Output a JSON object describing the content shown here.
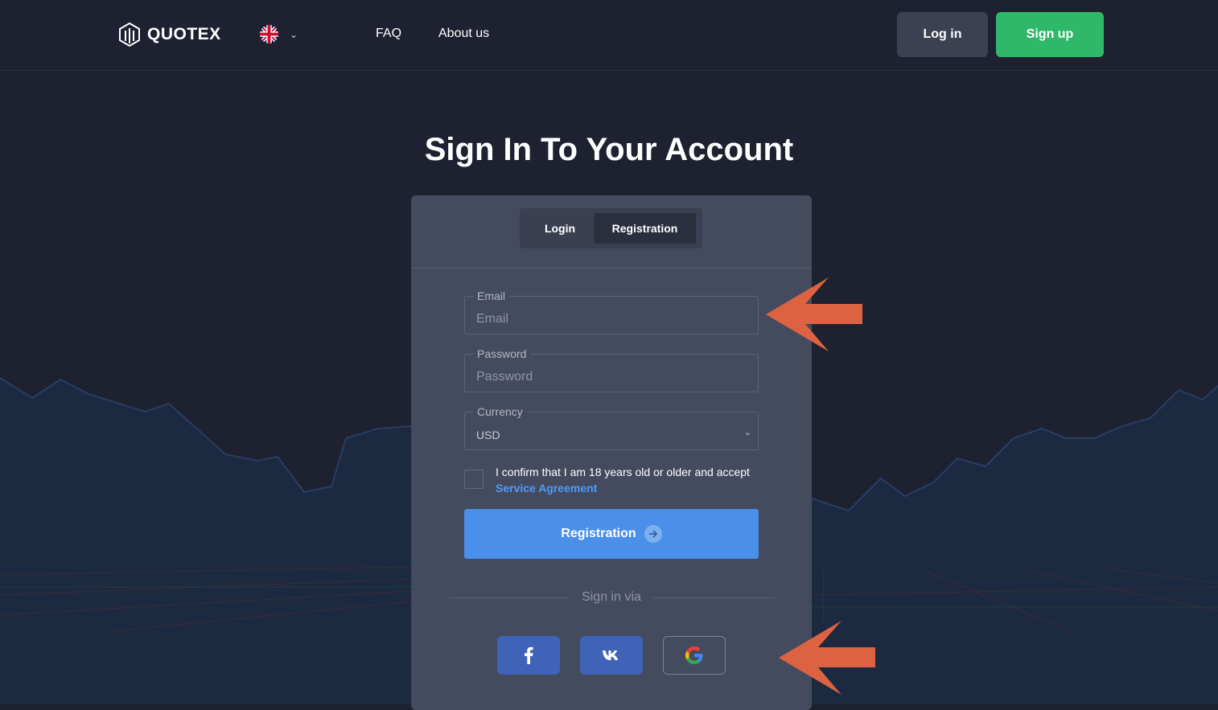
{
  "header": {
    "logo_text": "QUOTEX",
    "nav": {
      "faq": "FAQ",
      "about": "About us"
    },
    "login_label": "Log in",
    "signup_label": "Sign up"
  },
  "page": {
    "title": "Sign In To Your Account"
  },
  "form": {
    "tabs": {
      "login": "Login",
      "registration": "Registration"
    },
    "active_tab": "Registration",
    "email": {
      "label": "Email",
      "placeholder": "Email",
      "value": ""
    },
    "password": {
      "label": "Password",
      "placeholder": "Password",
      "value": ""
    },
    "currency": {
      "label": "Currency",
      "value": "USD"
    },
    "agreement": {
      "checked": false,
      "text": "I confirm that I am 18 years old or older and accept",
      "link": "Service Agreement"
    },
    "submit_label": "Registration",
    "sign_in_via": "Sign in via",
    "social": [
      "facebook-icon",
      "vk-icon",
      "google-icon"
    ]
  },
  "colors": {
    "background": "#1e2130",
    "card": "#454b5e",
    "signup_green": "#2fb86a",
    "registration_blue": "#4a8fe9",
    "link_blue": "#4c9bff",
    "annotation_arrow": "#dd6241"
  },
  "annotations": [
    "arrow-pointing-to-email",
    "arrow-pointing-to-social-login"
  ]
}
